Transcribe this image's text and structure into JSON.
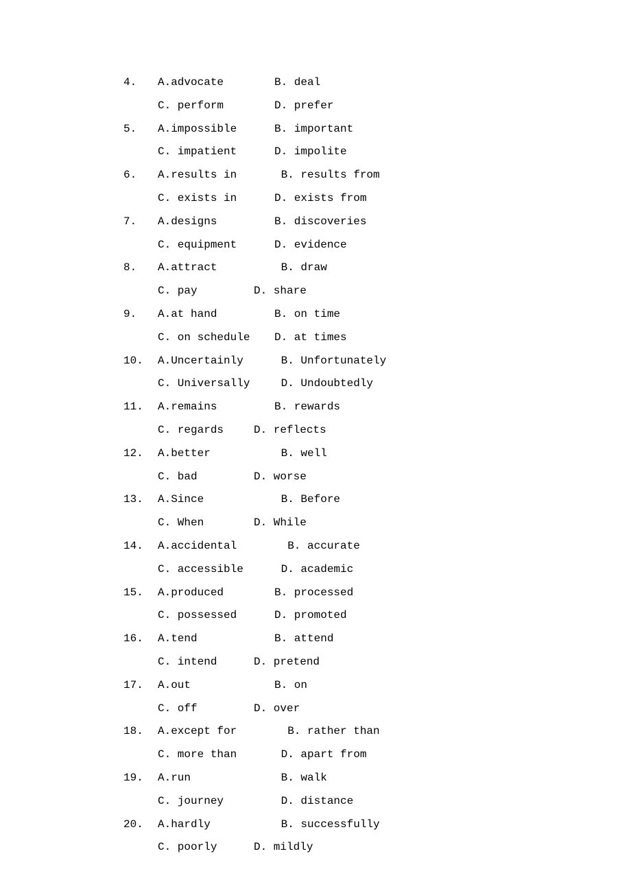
{
  "questions": [
    {
      "n": "4.",
      "a": "A.advocate",
      "b": "B. deal",
      "c": "C. perform",
      "d": "D. prefer"
    },
    {
      "n": "5.",
      "a": "A.impossible",
      "b": "B. important",
      "c": "C. impatient",
      "d": "D. impolite"
    },
    {
      "n": "6.",
      "a": "A.results in",
      "b": " B. results from",
      "c": "C. exists in",
      "d": "D. exists from"
    },
    {
      "n": "7.",
      "a": "A.designs",
      "b": "B. discoveries",
      "c": "C. equipment",
      "d": "D. evidence"
    },
    {
      "n": "8.",
      "a": "A.attract",
      "b": " B. draw",
      "c": "C. pay",
      "d": "D. share",
      "cNarrow": true
    },
    {
      "n": "9.",
      "a": "A.at hand",
      "b": "B. on time",
      "c": "C. on schedule",
      "d": "D. at times"
    },
    {
      "n": "10.",
      "a": "A.Uncertainly",
      "b": " B. Unfortunately",
      "c": "C. Universally",
      "d": " D. Undoubtedly"
    },
    {
      "n": "11.",
      "a": "A.remains",
      "b": "B. rewards",
      "c": "C. regards",
      "d": "D. reflects",
      "cNarrow": true
    },
    {
      "n": "12.",
      "a": "A.better",
      "b": " B. well",
      "c": "C. bad",
      "d": "D. worse",
      "cNarrow": true
    },
    {
      "n": "13.",
      "a": "A.Since",
      "b": " B. Before",
      "c": "C. When",
      "d": "D. While",
      "cNarrow": true
    },
    {
      "n": "14.",
      "a": "A.accidental",
      "b": "  B. accurate",
      "c": "C. accessible",
      "d": " D. academic"
    },
    {
      "n": "15.",
      "a": "A.produced",
      "b": "B. processed",
      "c": "C. possessed",
      "d": "D. promoted"
    },
    {
      "n": "16.",
      "a": "A.tend",
      "b": "B. attend",
      "c": "C. intend",
      "d": "D. pretend",
      "cNarrow": true
    },
    {
      "n": "17.",
      "a": "A.out",
      "b": "B. on",
      "c": "C. off",
      "d": "D. over",
      "cNarrow": true
    },
    {
      "n": "18.",
      "a": "A.except for",
      "b": "  B. rather than",
      "c": "C. more than",
      "d": " D. apart from"
    },
    {
      "n": "19.",
      "a": "A.run",
      "b": " B. walk",
      "c": "C. journey",
      "d": " D. distance"
    },
    {
      "n": "20.",
      "a": "A.hardly",
      "b": " B. successfully",
      "c": "C. poorly",
      "d": "D. mildly",
      "cNarrow": true
    }
  ]
}
